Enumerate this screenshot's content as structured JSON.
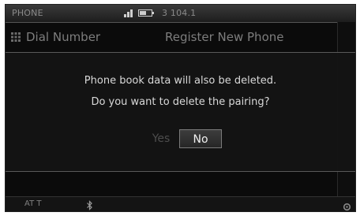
{
  "status": {
    "title": "PHONE",
    "signal_bars": 3,
    "battery_level": 0.6,
    "station": "3  104.1"
  },
  "menu": {
    "dial_number": "Dial Number",
    "register_new_phone": "Register New Phone"
  },
  "dialog": {
    "line1": "Phone book data will also be deleted.",
    "line2": "Do you want to delete the pairing?",
    "yes_label": "Yes",
    "no_label": "No"
  },
  "bottom": {
    "left_text": "AT T",
    "bluetooth_icon": "bluetooth-icon",
    "settings_icon": "settings-icon"
  }
}
